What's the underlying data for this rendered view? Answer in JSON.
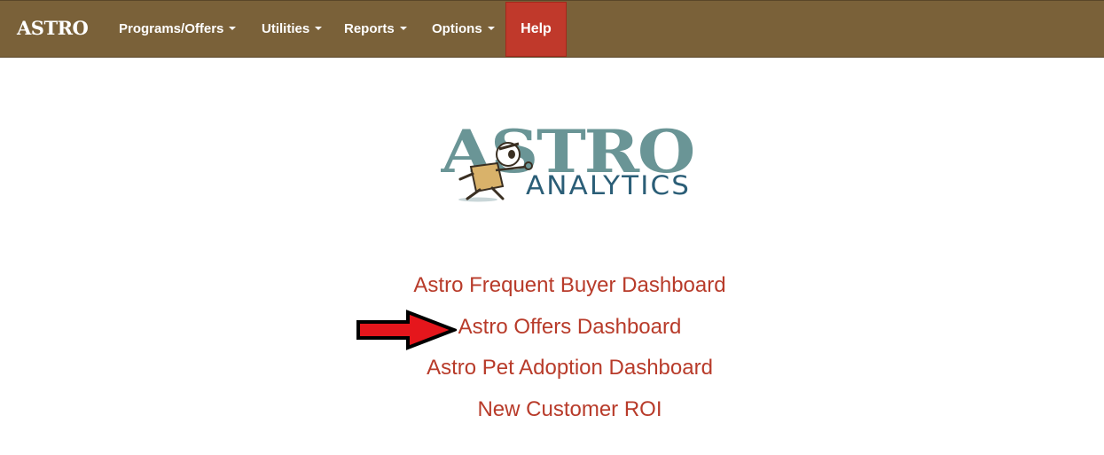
{
  "navbar": {
    "brand": "ASTRO",
    "menus": [
      {
        "label": "Programs/Offers"
      },
      {
        "label": "Utilities"
      },
      {
        "label": "Reports"
      },
      {
        "label": "Options"
      }
    ],
    "help_label": "Help"
  },
  "logo": {
    "title": "ASTRO",
    "subtitle": "ANALYTICS",
    "title_color": "#6a9596",
    "subtitle_color": "#2b5e77"
  },
  "dashboards": [
    {
      "label": "Astro Frequent Buyer Dashboard"
    },
    {
      "label": "Astro Offers Dashboard"
    },
    {
      "label": "Astro Pet Adoption Dashboard"
    },
    {
      "label": "New Customer ROI"
    }
  ],
  "colors": {
    "navbar": "#7a6139",
    "help": "#c0392b",
    "link": "#b83b2a",
    "arrow": "#e5161c"
  }
}
